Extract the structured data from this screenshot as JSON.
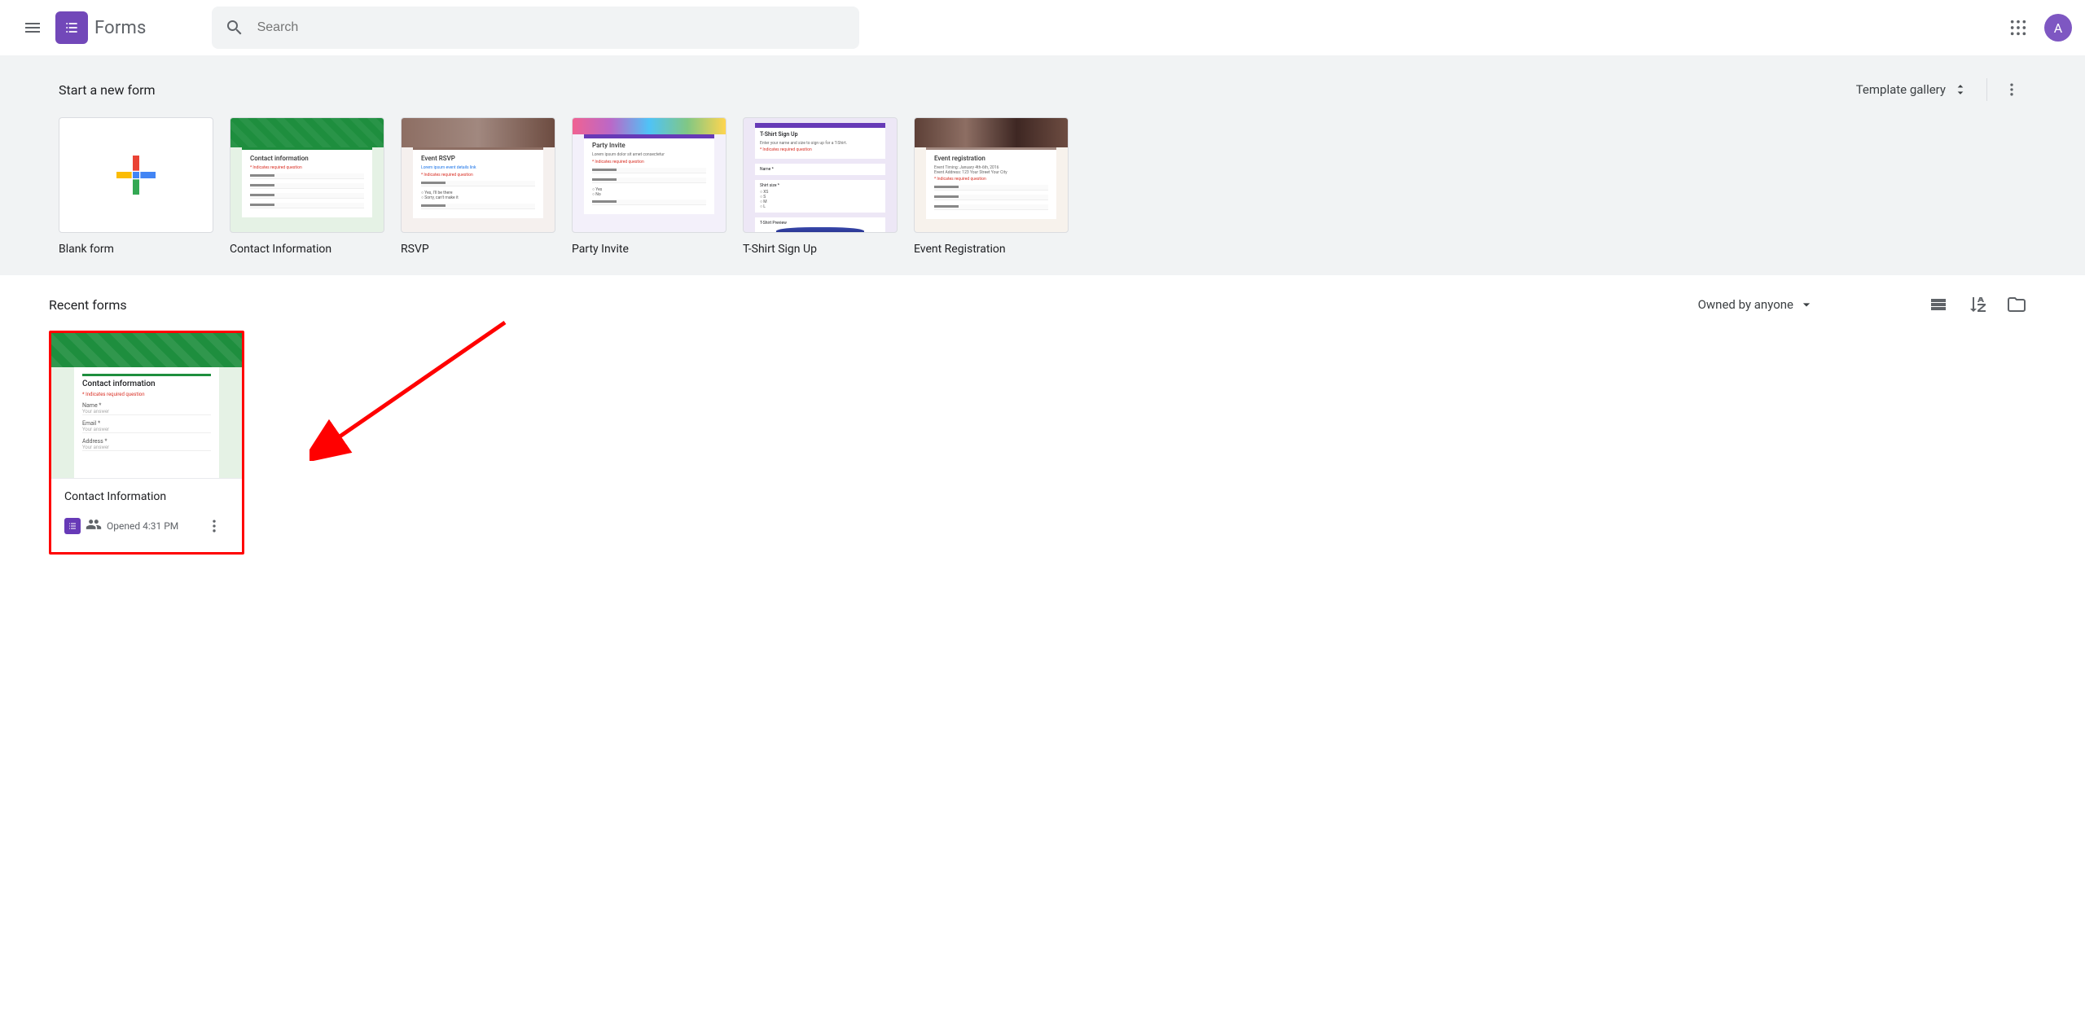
{
  "header": {
    "app_name": "Forms",
    "search_placeholder": "Search",
    "avatar_initial": "A"
  },
  "templates": {
    "section_title": "Start a new form",
    "gallery_label": "Template gallery",
    "items": [
      {
        "label": "Blank form",
        "kind": "blank"
      },
      {
        "label": "Contact Information",
        "kind": "contact",
        "thumb_title": "Contact information"
      },
      {
        "label": "RSVP",
        "kind": "rsvp",
        "thumb_title": "Event RSVP"
      },
      {
        "label": "Party Invite",
        "kind": "party",
        "thumb_title": "Party Invite"
      },
      {
        "label": "T-Shirt Sign Up",
        "kind": "tshirt",
        "thumb_title": "T-Shirt Sign Up"
      },
      {
        "label": "Event Registration",
        "kind": "event",
        "thumb_title": "Event registration"
      }
    ]
  },
  "recent": {
    "section_title": "Recent forms",
    "owner_filter_label": "Owned by anyone",
    "items": [
      {
        "name": "Contact Information",
        "thumb_title": "Contact information",
        "required_text": "* Indicates required question",
        "fields": [
          "Name *",
          "Email *",
          "Address *"
        ],
        "opened_text": "Opened 4:31 PM",
        "shared": true
      }
    ]
  },
  "annotation": {
    "highlight_target": "recent-card-0",
    "arrow": true
  },
  "colors": {
    "brand_purple": "#673ab7",
    "highlight_red": "#ff0000"
  }
}
